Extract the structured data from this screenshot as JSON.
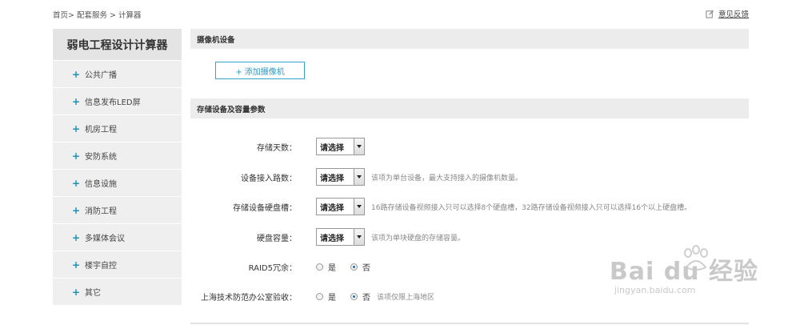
{
  "breadcrumb": {
    "text": "首页> 配套服务 > 计算器"
  },
  "feedback": {
    "label": "意见反馈",
    "icon": "edit-icon"
  },
  "sidebar": {
    "title": "弱电工程设计计算器",
    "items": [
      {
        "label": "公共广播"
      },
      {
        "label": "信息发布LED屏"
      },
      {
        "label": "机房工程"
      },
      {
        "label": "安防系统"
      },
      {
        "label": "信息设施"
      },
      {
        "label": "消防工程"
      },
      {
        "label": "多媒体会议"
      },
      {
        "label": "楼宇自控"
      },
      {
        "label": "其它"
      }
    ],
    "plus": "+"
  },
  "camera_section": {
    "title": "摄像机设备",
    "add_button": "+ 添加摄像机"
  },
  "storage_section": {
    "title": "存储设备及容量参数",
    "fields": {
      "days": {
        "label": "存储天数：",
        "value": "请选择",
        "hint": ""
      },
      "channels": {
        "label": "设备接入路数：",
        "value": "请选择",
        "hint": "该项为单台设备，最大支持接入的摄像机数量。"
      },
      "slots": {
        "label": "存储设备硬盘槽：",
        "value": "请选择",
        "hint": "16路存储设备视频接入只可以选择8个硬盘槽，32路存储设备视频接入只可以选择16个以上硬盘槽。"
      },
      "capacity": {
        "label": "硬盘容量：",
        "value": "请选择",
        "hint": "该项为单块硬盘的存储容量。"
      },
      "raid5": {
        "label": "RAID5冗余：",
        "yes": "是",
        "no": "否",
        "selected": "no"
      },
      "acceptance": {
        "label": "上海技术防范办公室验收：",
        "yes": "是",
        "no": "否",
        "selected": "no",
        "hint": "该项仅限上海地区"
      }
    }
  },
  "watermark": {
    "main": "Bai du 经验",
    "sub": "jingyan.baidu.com"
  }
}
